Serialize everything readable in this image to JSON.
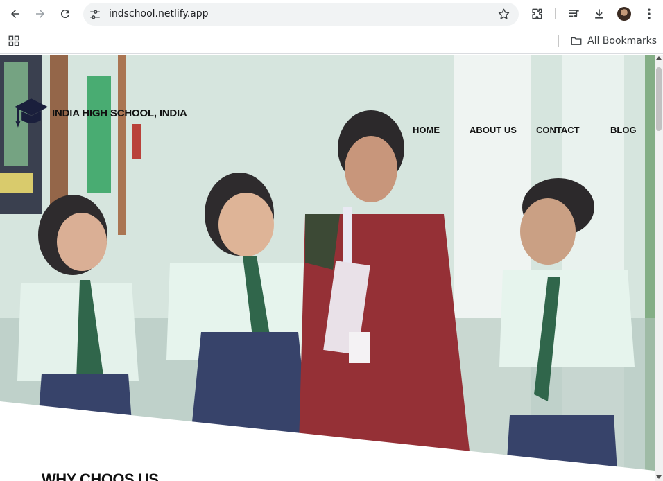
{
  "browser": {
    "url": "indschool.netlify.app",
    "bookmarks_label": "All Bookmarks"
  },
  "site": {
    "brand": "INDIA HIGH SCHOOL, INDIA",
    "nav": [
      {
        "label": "HOME"
      },
      {
        "label": "ABOUT US"
      },
      {
        "label": "CONTACT"
      },
      {
        "label": "BLOG"
      }
    ],
    "hero_image": "students-and-teacher-photo",
    "section_heading": "WHY CHOOS US"
  },
  "colors": {
    "brand_icon": "#1a1f3c",
    "nav_text": "#111111",
    "uniform_shirt": "#e4f3ec",
    "uniform_skirt": "#24335e",
    "saree": "#8c1f25",
    "tie_green": "#1f5a3c"
  }
}
